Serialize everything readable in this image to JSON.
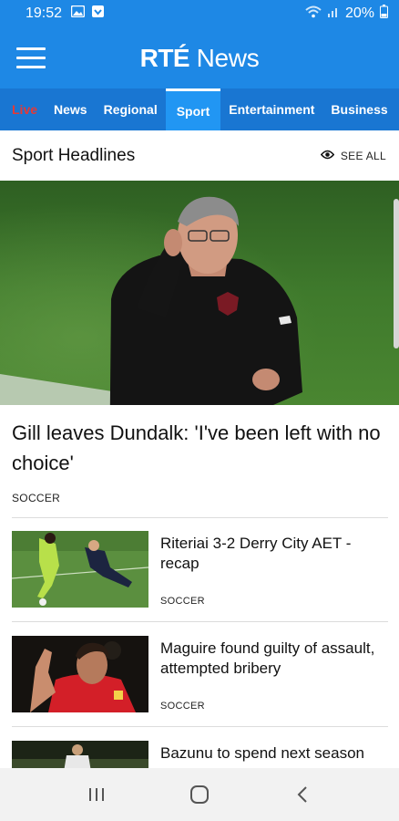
{
  "status_bar": {
    "time": "19:52",
    "battery": "20%",
    "icons": [
      "gallery-icon",
      "download-icon",
      "wifi-icon",
      "signal-icon",
      "battery-icon"
    ]
  },
  "app_bar": {
    "brand": "RTÉ",
    "title": "News",
    "menu_icon": "hamburger-menu-icon"
  },
  "tabs": [
    {
      "label": "Live"
    },
    {
      "label": "News"
    },
    {
      "label": "Regional"
    },
    {
      "label": "Sport"
    },
    {
      "label": "Entertainment"
    },
    {
      "label": "Business"
    }
  ],
  "active_tab": "Sport",
  "section": {
    "title": "Sport Headlines",
    "see_all": "SEE ALL",
    "see_all_icon": "eye-icon"
  },
  "hero": {
    "headline": "Gill leaves Dundalk: 'I've been left with no choice'",
    "category": "SOCCER"
  },
  "articles": [
    {
      "title": "Riteriai 3-2 Derry City AET - recap",
      "category": "SOCCER"
    },
    {
      "title": "Maguire found guilty of assault, attempted bribery",
      "category": "SOCCER"
    },
    {
      "title": "Bazunu to spend next season",
      "category": ""
    }
  ],
  "nav": {
    "recents_icon": "recents-icon",
    "home_icon": "home-icon",
    "back_icon": "back-icon"
  },
  "colors": {
    "app_bar": "#1e88e5",
    "tab_bar": "#1976d2",
    "active_tab": "#2196f3",
    "live_tab": "#e53935"
  }
}
